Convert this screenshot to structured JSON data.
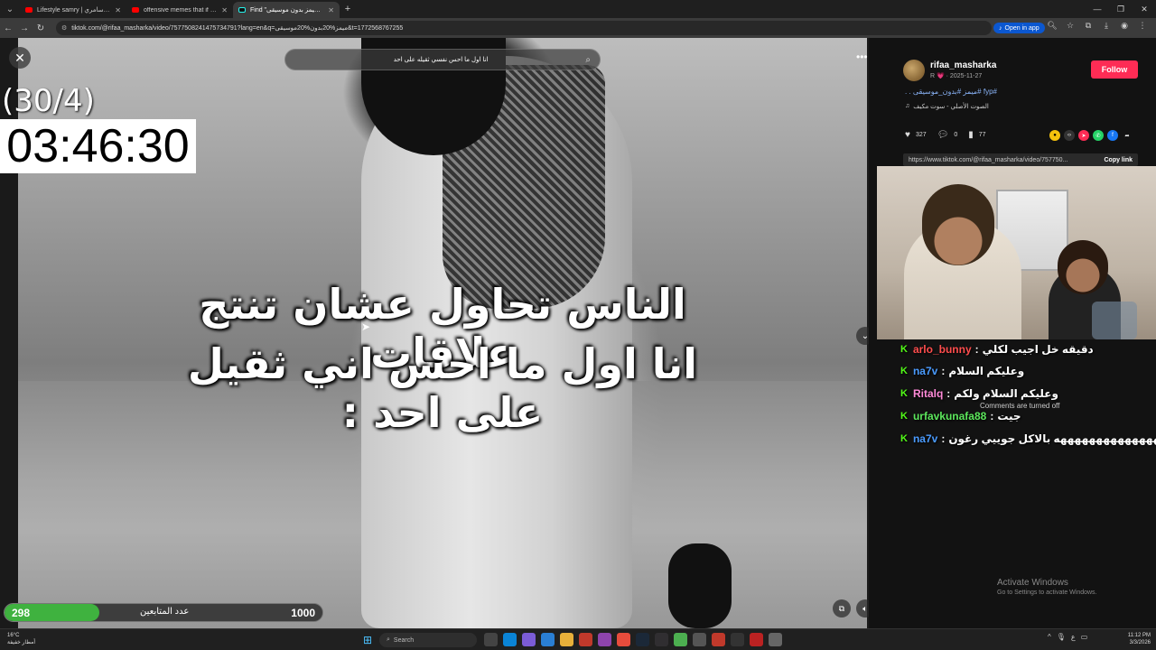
{
  "browser": {
    "tabs": [
      {
        "label": "Lifestyle samry | ستايل سامري",
        "icon": "youtube-icon",
        "active": false
      },
      {
        "label": "offensive memes that if ylyl 10...",
        "icon": "youtube-icon",
        "active": false
      },
      {
        "label": "Find \"ميمز بدون موسيقى\" on...",
        "icon": "tiktok-icon",
        "active": true
      }
    ],
    "new_tab": "+",
    "url": "tiktok.com/@rifaa_masharka/video/7577508241475734791?lang=en&q=ميمز%20بدون%20موسيقى&t=1772568767255",
    "open_in_app": "Open in app"
  },
  "video": {
    "search_query": "انا اول ما احس نفسي ثقيله على احد",
    "caption_line1": "الناس تحاول عشان تنتج علاقات",
    "caption_line2": "انا اول ما احس اني ثقيل على احد :"
  },
  "stream": {
    "counter": "(30/4)",
    "timer": "03:46:30",
    "followers_current": "298",
    "followers_label": "عدد المتابعين",
    "followers_goal": "1000",
    "followers_progress": 0.298
  },
  "post": {
    "username": "rifaa_masharka",
    "date": "R 💗 · 2025-11-27",
    "follow": "Follow",
    "caption": "#fyp #ميمز #بدون_موسيقى . .",
    "sound": "الصوت الأصلي - سوت مكيف",
    "likes": "327",
    "comments": "0",
    "saves": "77",
    "link": "https://www.tiktok.com/@rifaa_masharka/video/757750...",
    "copy_link": "Copy link"
  },
  "chat": [
    {
      "user": "arlo_bunny",
      "color": "#ff4d4d",
      "msg": "دقيقه خل اجيب لكلي"
    },
    {
      "user": "na7v",
      "color": "#4a9bff",
      "msg": "وعليكم السلام"
    },
    {
      "user": "Ritalq",
      "color": "#ff8ad8",
      "msg": "وعليكم السلام ولكم"
    },
    {
      "user": "urfavkunafa88",
      "color": "#5ce65c",
      "msg": "جيت"
    },
    {
      "user": "na7v",
      "color": "#4a9bff",
      "msg": "هههههههههههههههههه بالاكل جوييي رغون"
    }
  ],
  "comments_off": "Comments are turned off",
  "activate": {
    "title": "Activate Windows",
    "sub": "Go to Settings to activate Windows."
  },
  "taskbar": {
    "temp": "16°C",
    "weather": "أمطار خفيفة",
    "search": "Search",
    "time": "11:12 PM",
    "date": "3/3/2026"
  }
}
